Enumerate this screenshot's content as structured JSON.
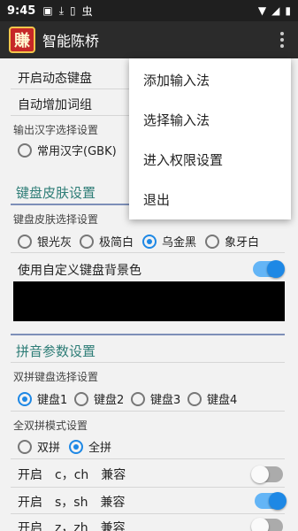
{
  "status": {
    "time": "9:45",
    "icons": [
      "image-icon",
      "download-icon",
      "sim-alert-icon",
      "app-icon"
    ],
    "right_icons": [
      "wifi-icon",
      "signal-icon",
      "battery-icon"
    ]
  },
  "app": {
    "logo_char": "賺",
    "title": "智能陈桥"
  },
  "settings": {
    "dynamic_keyboard": "开启动态键盘",
    "auto_add_words": "自动增加词组",
    "hanzi_caption": "输出汉字选择设置",
    "hanzi_option": "常用汉字(GBK)"
  },
  "skin": {
    "section_title": "键盘皮肤设置",
    "caption": "键盘皮肤选择设置",
    "options": [
      "银光灰",
      "极简白",
      "乌金黑",
      "象牙白"
    ],
    "selected": "乌金黑",
    "custom_bg_label": "使用自定义键盘背景色",
    "custom_bg_on": true,
    "custom_bg_color": "#000000"
  },
  "pinyin": {
    "section_title": "拼音参数设置",
    "double_caption": "双拼键盘选择设置",
    "keyboards": [
      "键盘1",
      "键盘2",
      "键盘3",
      "键盘4"
    ],
    "keyboard_selected": "键盘1",
    "mode_caption": "全双拼模式设置",
    "modes": [
      "双拼",
      "全拼"
    ],
    "mode_selected": "全拼",
    "compat": [
      {
        "label": "开启　c，ch　兼容",
        "on": false
      },
      {
        "label": "开启　s，sh　兼容",
        "on": true
      },
      {
        "label": "开启　z，zh　兼容",
        "on": false
      }
    ]
  },
  "menu": {
    "items": [
      "添加输入法",
      "选择输入法",
      "进入权限设置",
      "退出"
    ]
  },
  "colors": {
    "accent": "#1e88e5",
    "section": "#2e7d77",
    "appbar": "#2b2b2b"
  }
}
